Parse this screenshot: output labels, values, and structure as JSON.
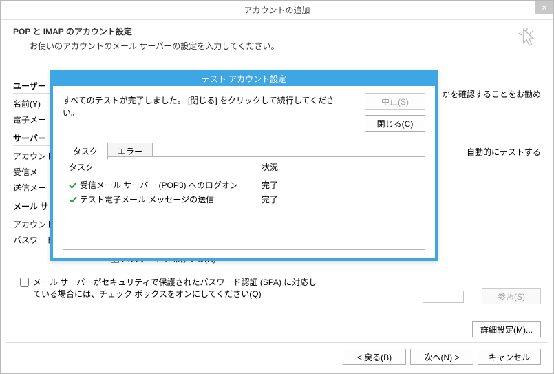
{
  "window": {
    "title": "アカウントの追加",
    "header_title": "POP と IMAP のアカウント設定",
    "header_sub": "お使いのアカウントのメール サーバーの設定を入力してください。"
  },
  "groups": {
    "user": "ユーザー",
    "name": "名前(Y)",
    "email": "電子メー",
    "server": "サーバー",
    "account": "アカウント",
    "incoming": "受信メー",
    "outgoing": "送信メー",
    "mailsec": "メール サ",
    "account2": "アカウント",
    "password": "パスワード"
  },
  "right": {
    "advice": "かを確認することをお勧め",
    "autotest": "自動的にテストする"
  },
  "truncated_check": "パスワードを保存する(R)",
  "spa": {
    "line1": "メール サーバーがセキュリティで保護されたパスワード認証 (SPA) に対応し",
    "line2": "ている場合には、チェック ボックスをオンにしてください(Q)"
  },
  "buttons": {
    "browse": "参照(S)",
    "detail": "詳細設定(M)...",
    "back": "< 戻る(B)",
    "next": "次へ(N) >",
    "cancel": "キャンセル"
  },
  "modal": {
    "title": "テスト アカウント設定",
    "msg": "すべてのテストが完了しました。 [閉じる] をクリックして続行してください。",
    "stop": "中止(S)",
    "close": "閉じる(C)",
    "tabs": {
      "tasks": "タスク",
      "errors": "エラー"
    },
    "headers": {
      "task": "タスク",
      "status": "状況"
    },
    "rows": [
      {
        "task": "受信メール サーバー (POP3) へのログオン",
        "status": "完了"
      },
      {
        "task": "テスト電子メール メッセージの送信",
        "status": "完了"
      }
    ]
  }
}
